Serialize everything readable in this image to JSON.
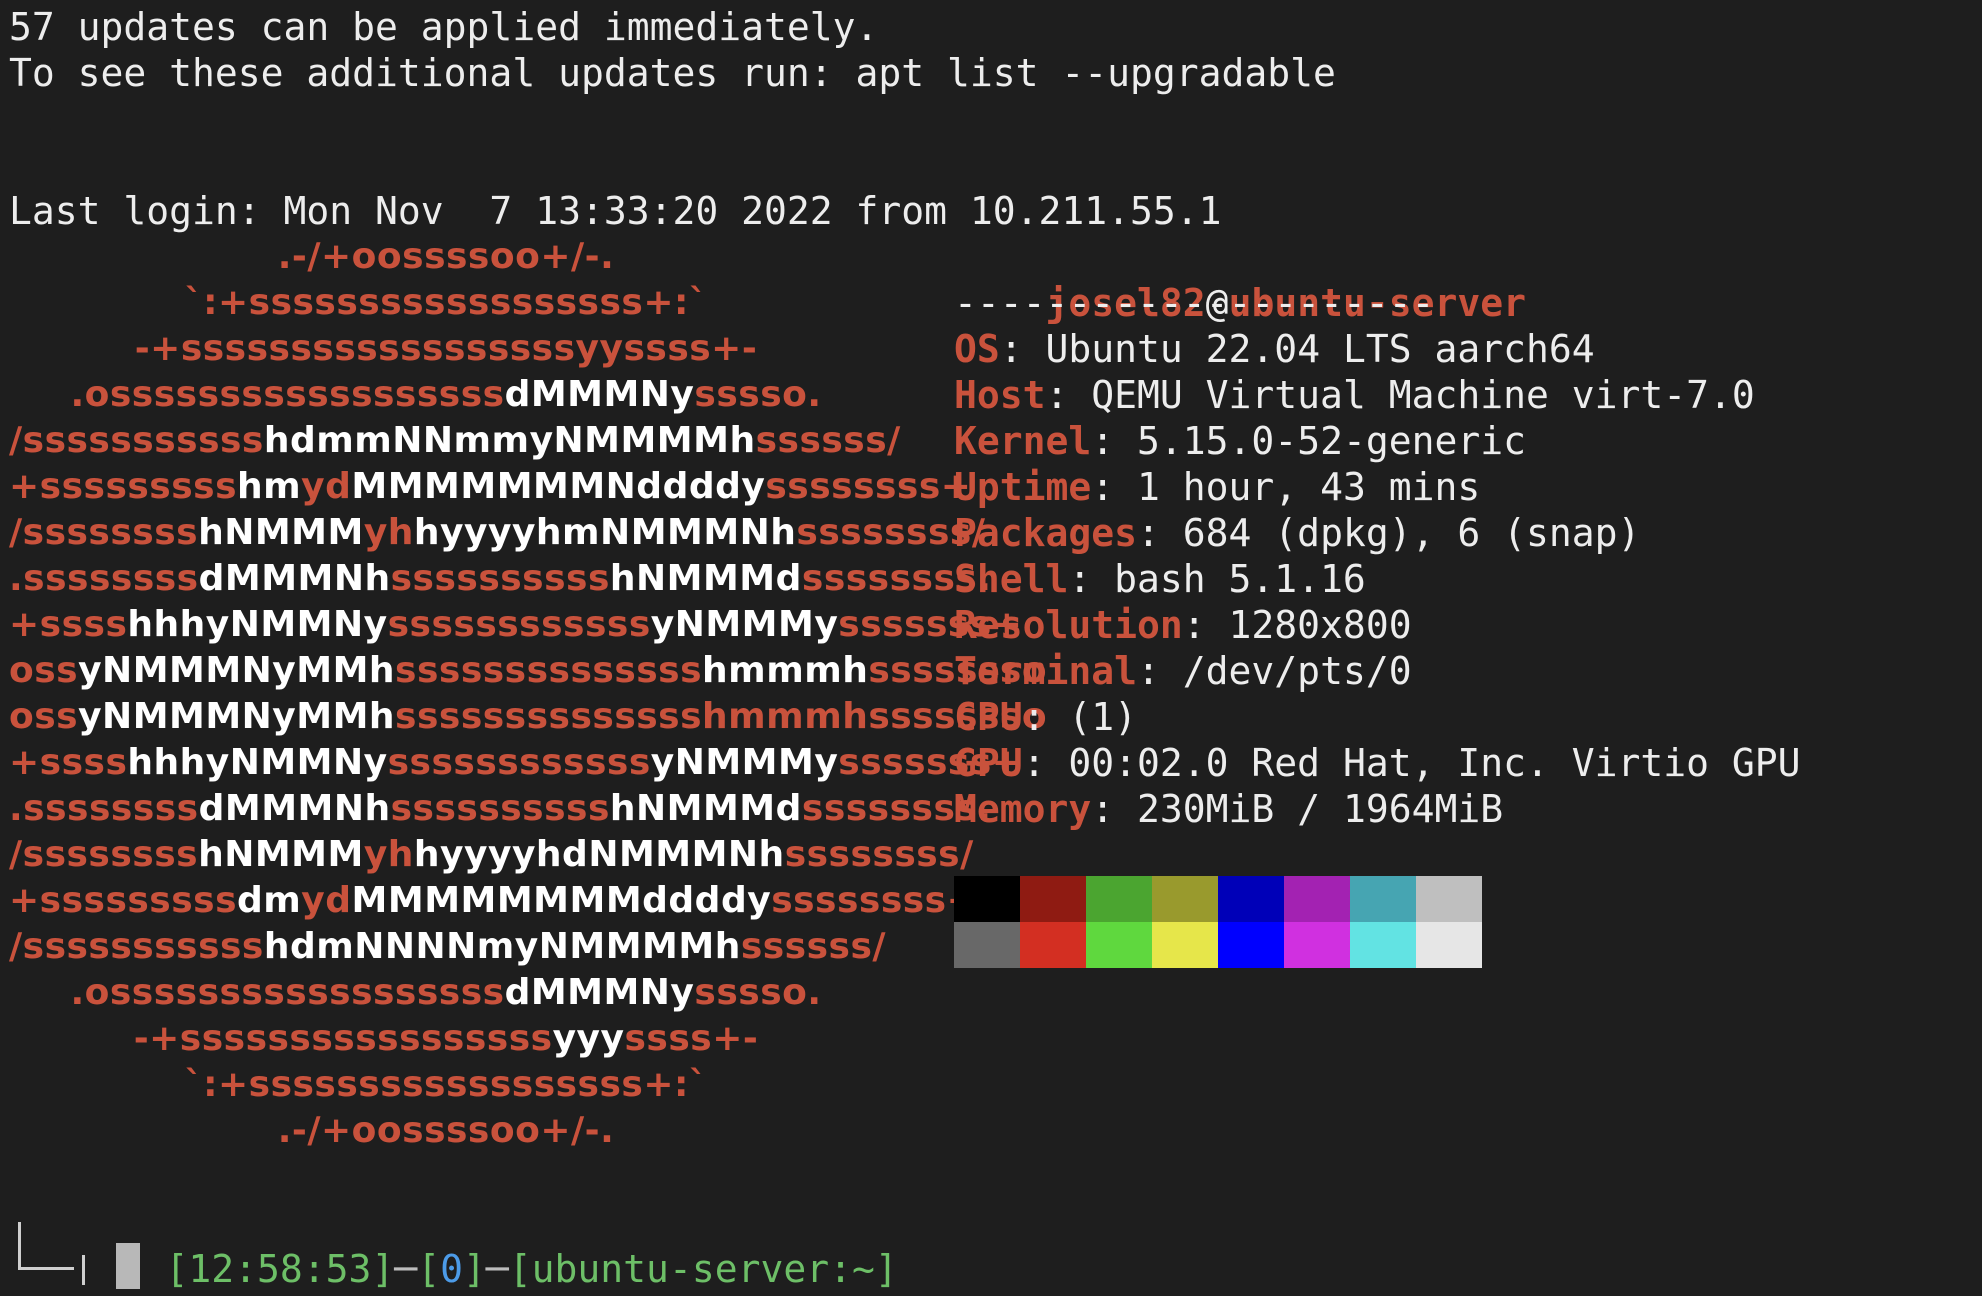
{
  "motd": {
    "updates_line": "57 updates can be applied immediately.",
    "apt_line": "To see these additional updates run: apt list --upgradable",
    "last_login": "Last login: Mon Nov  7 13:33:20 2022 from 10.211.55.1"
  },
  "logo": [
    [
      {
        "t": ".-/+oossssoo+/-.",
        "c": "r"
      }
    ],
    [
      {
        "t": "`:+ssssssssssssssssss+:`",
        "c": "r"
      }
    ],
    [
      {
        "t": "-+ssssssssssssssssssyyssss+-",
        "c": "r"
      }
    ],
    [
      {
        "t": ".ossssssssssssssssss",
        "c": "r"
      },
      {
        "t": "dMMMNy",
        "c": "w"
      },
      {
        "t": "sssso.",
        "c": "r"
      }
    ],
    [
      {
        "t": "/sssssssssss",
        "c": "r"
      },
      {
        "t": "hdmmNNmmyNMMMMh",
        "c": "w"
      },
      {
        "t": "ssssss/",
        "c": "r"
      }
    ],
    [
      {
        "t": "+sssssssss",
        "c": "r"
      },
      {
        "t": "hm",
        "c": "w"
      },
      {
        "t": "yd",
        "c": "r"
      },
      {
        "t": "MMMMMMMNddddy",
        "c": "w"
      },
      {
        "t": "ssssssss+",
        "c": "r"
      }
    ],
    [
      {
        "t": "/ssssssss",
        "c": "r"
      },
      {
        "t": "hNMMM",
        "c": "w"
      },
      {
        "t": "yh",
        "c": "r"
      },
      {
        "t": "hyyyyhmNMMMNh",
        "c": "w"
      },
      {
        "t": "ssssssss/",
        "c": "r"
      }
    ],
    [
      {
        "t": ".ssssssss",
        "c": "r"
      },
      {
        "t": "dMMMNh",
        "c": "w"
      },
      {
        "t": "ssssssssss",
        "c": "r"
      },
      {
        "t": "hNMMMd",
        "c": "w"
      },
      {
        "t": "ssssssss.",
        "c": "r"
      }
    ],
    [
      {
        "t": "+ssss",
        "c": "r"
      },
      {
        "t": "hhhyNMMNy",
        "c": "w"
      },
      {
        "t": "ssssssssssss",
        "c": "r"
      },
      {
        "t": "yNMMMy",
        "c": "w"
      },
      {
        "t": "sssssss+",
        "c": "r"
      }
    ],
    [
      {
        "t": "oss",
        "c": "r"
      },
      {
        "t": "yNMMMNyMMh",
        "c": "w"
      },
      {
        "t": "ssssssssssssss",
        "c": "r"
      },
      {
        "t": "hmmmh",
        "c": "w"
      },
      {
        "t": "ssssssso",
        "c": "r"
      }
    ],
    [
      {
        "t": "oss",
        "c": "r"
      },
      {
        "t": "yNMMMNyMMh",
        "c": "w"
      },
      {
        "t": "sssssssssssssshmmmhssssssso",
        "c": "r"
      }
    ],
    [
      {
        "t": "+ssss",
        "c": "r"
      },
      {
        "t": "hhhyNMMNy",
        "c": "w"
      },
      {
        "t": "ssssssssssss",
        "c": "r"
      },
      {
        "t": "yNMMMy",
        "c": "w"
      },
      {
        "t": "sssssss+",
        "c": "r"
      }
    ],
    [
      {
        "t": ".ssssssss",
        "c": "r"
      },
      {
        "t": "dMMMNh",
        "c": "w"
      },
      {
        "t": "ssssssssss",
        "c": "r"
      },
      {
        "t": "hNMMMd",
        "c": "w"
      },
      {
        "t": "ssssssss.",
        "c": "r"
      }
    ],
    [
      {
        "t": "/ssssssss",
        "c": "r"
      },
      {
        "t": "hNMMM",
        "c": "w"
      },
      {
        "t": "yh",
        "c": "r"
      },
      {
        "t": "hyyyyhdNMMMNh",
        "c": "w"
      },
      {
        "t": "ssssssss/",
        "c": "r"
      }
    ],
    [
      {
        "t": "+sssssssss",
        "c": "r"
      },
      {
        "t": "dm",
        "c": "w"
      },
      {
        "t": "yd",
        "c": "r"
      },
      {
        "t": "MMMMMMMMddddy",
        "c": "w"
      },
      {
        "t": "ssssssss+",
        "c": "r"
      }
    ],
    [
      {
        "t": "/sssssssssss",
        "c": "r"
      },
      {
        "t": "hdmNNNNmyNMMMMh",
        "c": "w"
      },
      {
        "t": "ssssss/",
        "c": "r"
      }
    ],
    [
      {
        "t": ".ossssssssssssssssss",
        "c": "r"
      },
      {
        "t": "dMMMNy",
        "c": "w"
      },
      {
        "t": "sssso.",
        "c": "r"
      }
    ],
    [
      {
        "t": "-+sssssssssssssssss",
        "c": "r"
      },
      {
        "t": "yyy",
        "c": "w"
      },
      {
        "t": "ssss+-",
        "c": "r"
      }
    ],
    [
      {
        "t": "`:+ssssssssssssssssss+:`",
        "c": "r"
      }
    ],
    [
      {
        "t": ".-/+oossssoo+/-.",
        "c": "r"
      }
    ]
  ],
  "info": {
    "user": "josel82",
    "at": "@",
    "host": "ubuntu-server",
    "separator": "---------------------",
    "fields": [
      {
        "key": "OS",
        "value": "Ubuntu 22.04 LTS aarch64"
      },
      {
        "key": "Host",
        "value": "QEMU Virtual Machine virt-7.0"
      },
      {
        "key": "Kernel",
        "value": "5.15.0-52-generic"
      },
      {
        "key": "Uptime",
        "value": "1 hour, 43 mins"
      },
      {
        "key": "Packages",
        "value": "684 (dpkg), 6 (snap)"
      },
      {
        "key": "Shell",
        "value": "bash 5.1.16"
      },
      {
        "key": "Resolution",
        "value": "1280x800"
      },
      {
        "key": "Terminal",
        "value": "/dev/pts/0"
      },
      {
        "key": "CPU",
        "value": "(1)"
      },
      {
        "key": "GPU",
        "value": "00:02.0 Red Hat, Inc. Virtio GPU"
      },
      {
        "key": "Memory",
        "value": "230MiB / 1964MiB"
      }
    ]
  },
  "palette": [
    "#000000",
    "#8f1b12",
    "#4ba530",
    "#999a2d",
    "#0000b8",
    "#a322b2",
    "#46a5b2",
    "#bfbfbf",
    "#686868",
    "#d32f22",
    "#5fd83e",
    "#e6e64a",
    "#0000ff",
    "#d030e0",
    "#62e3e3",
    "#e6e6e6"
  ],
  "prompt": {
    "open1": "[",
    "time": "12:58:53",
    "close1": "]",
    "dash1": "─",
    "open2": "[",
    "status": "0",
    "close2": "]",
    "dash2": "─",
    "open3": "[",
    "location": "ubuntu-server:~",
    "close3": "]"
  }
}
